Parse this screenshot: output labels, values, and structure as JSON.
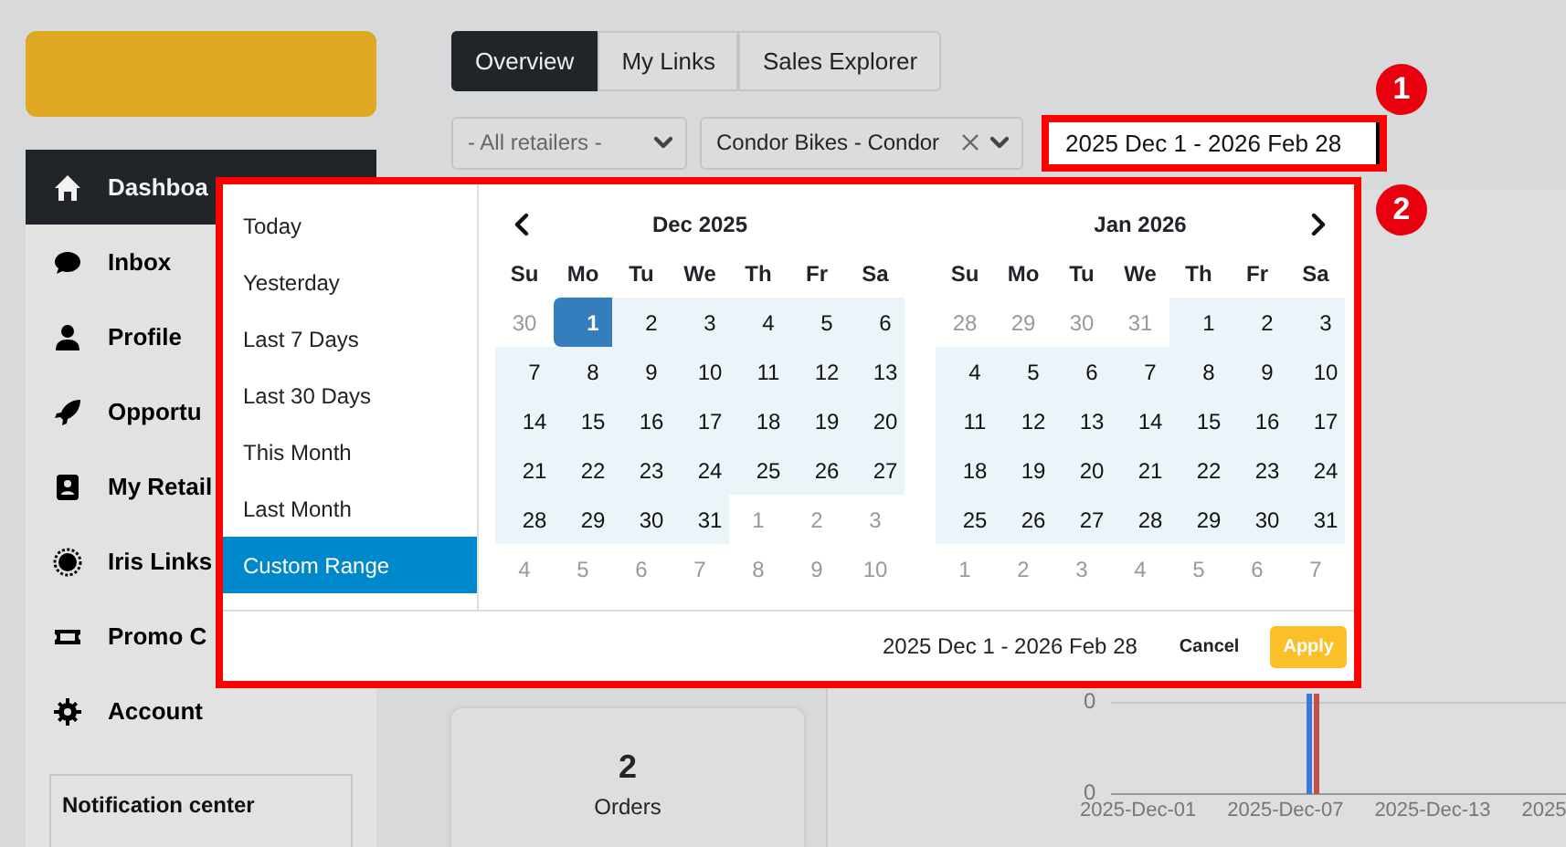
{
  "sidebar": {
    "items": [
      {
        "label": "Dashboa",
        "selected": true
      },
      {
        "label": "Inbox",
        "selected": false
      },
      {
        "label": "Profile",
        "selected": false
      },
      {
        "label": "Opportu",
        "selected": false
      },
      {
        "label": "My Retail",
        "selected": false
      },
      {
        "label": "Iris Links",
        "selected": false
      },
      {
        "label": "Promo C",
        "selected": false
      },
      {
        "label": "Account",
        "selected": false
      }
    ],
    "notification_center": {
      "title": "Notification center"
    }
  },
  "tabs": [
    {
      "label": "Overview",
      "selected": true
    },
    {
      "label": "My Links",
      "selected": false
    },
    {
      "label": "Sales Explorer",
      "selected": false
    }
  ],
  "filters": {
    "retailer": {
      "value": "- All retailers -"
    },
    "brand": {
      "value": "Condor Bikes - Condor"
    },
    "date_range": {
      "value": "2025 Dec 1 - 2026 Feb 28"
    }
  },
  "stat_card": {
    "value": "2",
    "label": "Orders"
  },
  "chart": {
    "y_labels": [
      "0",
      "0"
    ],
    "x_labels": [
      "2025-Dec-01",
      "2025-Dec-07",
      "2025-Dec-13",
      "2025"
    ]
  },
  "date_picker": {
    "ranges": [
      {
        "label": "Today",
        "selected": false
      },
      {
        "label": "Yesterday",
        "selected": false
      },
      {
        "label": "Last 7 Days",
        "selected": false
      },
      {
        "label": "Last 30 Days",
        "selected": false
      },
      {
        "label": "This Month",
        "selected": false
      },
      {
        "label": "Last Month",
        "selected": false
      },
      {
        "label": "Custom Range",
        "selected": true
      }
    ],
    "months": [
      {
        "title": "Dec 2025",
        "weekdays": [
          "Su",
          "Mo",
          "Tu",
          "We",
          "Th",
          "Fr",
          "Sa"
        ],
        "weeks": [
          [
            {
              "day": "30",
              "outside": true,
              "in_range": false,
              "selected": false
            },
            {
              "day": "1",
              "outside": false,
              "in_range": true,
              "selected": true
            },
            {
              "day": "2",
              "outside": false,
              "in_range": true,
              "selected": false
            },
            {
              "day": "3",
              "outside": false,
              "in_range": true,
              "selected": false
            },
            {
              "day": "4",
              "outside": false,
              "in_range": true,
              "selected": false
            },
            {
              "day": "5",
              "outside": false,
              "in_range": true,
              "selected": false
            },
            {
              "day": "6",
              "outside": false,
              "in_range": true,
              "selected": false
            }
          ],
          [
            {
              "day": "7",
              "outside": false,
              "in_range": true,
              "selected": false
            },
            {
              "day": "8",
              "outside": false,
              "in_range": true,
              "selected": false
            },
            {
              "day": "9",
              "outside": false,
              "in_range": true,
              "selected": false
            },
            {
              "day": "10",
              "outside": false,
              "in_range": true,
              "selected": false
            },
            {
              "day": "11",
              "outside": false,
              "in_range": true,
              "selected": false
            },
            {
              "day": "12",
              "outside": false,
              "in_range": true,
              "selected": false
            },
            {
              "day": "13",
              "outside": false,
              "in_range": true,
              "selected": false
            }
          ],
          [
            {
              "day": "14",
              "outside": false,
              "in_range": true,
              "selected": false
            },
            {
              "day": "15",
              "outside": false,
              "in_range": true,
              "selected": false
            },
            {
              "day": "16",
              "outside": false,
              "in_range": true,
              "selected": false
            },
            {
              "day": "17",
              "outside": false,
              "in_range": true,
              "selected": false
            },
            {
              "day": "18",
              "outside": false,
              "in_range": true,
              "selected": false
            },
            {
              "day": "19",
              "outside": false,
              "in_range": true,
              "selected": false
            },
            {
              "day": "20",
              "outside": false,
              "in_range": true,
              "selected": false
            }
          ],
          [
            {
              "day": "21",
              "outside": false,
              "in_range": true,
              "selected": false
            },
            {
              "day": "22",
              "outside": false,
              "in_range": true,
              "selected": false
            },
            {
              "day": "23",
              "outside": false,
              "in_range": true,
              "selected": false
            },
            {
              "day": "24",
              "outside": false,
              "in_range": true,
              "selected": false
            },
            {
              "day": "25",
              "outside": false,
              "in_range": true,
              "selected": false
            },
            {
              "day": "26",
              "outside": false,
              "in_range": true,
              "selected": false
            },
            {
              "day": "27",
              "outside": false,
              "in_range": true,
              "selected": false
            }
          ],
          [
            {
              "day": "28",
              "outside": false,
              "in_range": true,
              "selected": false
            },
            {
              "day": "29",
              "outside": false,
              "in_range": true,
              "selected": false
            },
            {
              "day": "30",
              "outside": false,
              "in_range": true,
              "selected": false
            },
            {
              "day": "31",
              "outside": false,
              "in_range": true,
              "selected": false
            },
            {
              "day": "1",
              "outside": true,
              "in_range": false,
              "selected": false
            },
            {
              "day": "2",
              "outside": true,
              "in_range": false,
              "selected": false
            },
            {
              "day": "3",
              "outside": true,
              "in_range": false,
              "selected": false
            }
          ],
          [
            {
              "day": "4",
              "outside": true,
              "in_range": false,
              "selected": false
            },
            {
              "day": "5",
              "outside": true,
              "in_range": false,
              "selected": false
            },
            {
              "day": "6",
              "outside": true,
              "in_range": false,
              "selected": false
            },
            {
              "day": "7",
              "outside": true,
              "in_range": false,
              "selected": false
            },
            {
              "day": "8",
              "outside": true,
              "in_range": false,
              "selected": false
            },
            {
              "day": "9",
              "outside": true,
              "in_range": false,
              "selected": false
            },
            {
              "day": "10",
              "outside": true,
              "in_range": false,
              "selected": false
            }
          ]
        ]
      },
      {
        "title": "Jan 2026",
        "weekdays": [
          "Su",
          "Mo",
          "Tu",
          "We",
          "Th",
          "Fr",
          "Sa"
        ],
        "weeks": [
          [
            {
              "day": "28",
              "outside": true,
              "in_range": false,
              "selected": false
            },
            {
              "day": "29",
              "outside": true,
              "in_range": false,
              "selected": false
            },
            {
              "day": "30",
              "outside": true,
              "in_range": false,
              "selected": false
            },
            {
              "day": "31",
              "outside": true,
              "in_range": false,
              "selected": false
            },
            {
              "day": "1",
              "outside": false,
              "in_range": true,
              "selected": false
            },
            {
              "day": "2",
              "outside": false,
              "in_range": true,
              "selected": false
            },
            {
              "day": "3",
              "outside": false,
              "in_range": true,
              "selected": false
            }
          ],
          [
            {
              "day": "4",
              "outside": false,
              "in_range": true,
              "selected": false
            },
            {
              "day": "5",
              "outside": false,
              "in_range": true,
              "selected": false
            },
            {
              "day": "6",
              "outside": false,
              "in_range": true,
              "selected": false
            },
            {
              "day": "7",
              "outside": false,
              "in_range": true,
              "selected": false
            },
            {
              "day": "8",
              "outside": false,
              "in_range": true,
              "selected": false
            },
            {
              "day": "9",
              "outside": false,
              "in_range": true,
              "selected": false
            },
            {
              "day": "10",
              "outside": false,
              "in_range": true,
              "selected": false
            }
          ],
          [
            {
              "day": "11",
              "outside": false,
              "in_range": true,
              "selected": false
            },
            {
              "day": "12",
              "outside": false,
              "in_range": true,
              "selected": false
            },
            {
              "day": "13",
              "outside": false,
              "in_range": true,
              "selected": false
            },
            {
              "day": "14",
              "outside": false,
              "in_range": true,
              "selected": false
            },
            {
              "day": "15",
              "outside": false,
              "in_range": true,
              "selected": false
            },
            {
              "day": "16",
              "outside": false,
              "in_range": true,
              "selected": false
            },
            {
              "day": "17",
              "outside": false,
              "in_range": true,
              "selected": false
            }
          ],
          [
            {
              "day": "18",
              "outside": false,
              "in_range": true,
              "selected": false
            },
            {
              "day": "19",
              "outside": false,
              "in_range": true,
              "selected": false
            },
            {
              "day": "20",
              "outside": false,
              "in_range": true,
              "selected": false
            },
            {
              "day": "21",
              "outside": false,
              "in_range": true,
              "selected": false
            },
            {
              "day": "22",
              "outside": false,
              "in_range": true,
              "selected": false
            },
            {
              "day": "23",
              "outside": false,
              "in_range": true,
              "selected": false
            },
            {
              "day": "24",
              "outside": false,
              "in_range": true,
              "selected": false
            }
          ],
          [
            {
              "day": "25",
              "outside": false,
              "in_range": true,
              "selected": false
            },
            {
              "day": "26",
              "outside": false,
              "in_range": true,
              "selected": false
            },
            {
              "day": "27",
              "outside": false,
              "in_range": true,
              "selected": false
            },
            {
              "day": "28",
              "outside": false,
              "in_range": true,
              "selected": false
            },
            {
              "day": "29",
              "outside": false,
              "in_range": true,
              "selected": false
            },
            {
              "day": "30",
              "outside": false,
              "in_range": true,
              "selected": false
            },
            {
              "day": "31",
              "outside": false,
              "in_range": true,
              "selected": false
            }
          ],
          [
            {
              "day": "1",
              "outside": true,
              "in_range": false,
              "selected": false
            },
            {
              "day": "2",
              "outside": true,
              "in_range": false,
              "selected": false
            },
            {
              "day": "3",
              "outside": true,
              "in_range": false,
              "selected": false
            },
            {
              "day": "4",
              "outside": true,
              "in_range": false,
              "selected": false
            },
            {
              "day": "5",
              "outside": true,
              "in_range": false,
              "selected": false
            },
            {
              "day": "6",
              "outside": true,
              "in_range": false,
              "selected": false
            },
            {
              "day": "7",
              "outside": true,
              "in_range": false,
              "selected": false
            }
          ]
        ]
      }
    ],
    "summary": "2025 Dec 1 - 2026 Feb 28",
    "buttons": [
      {
        "label": "Cancel",
        "kind": "plain"
      },
      {
        "label": "Apply",
        "kind": "primary"
      }
    ]
  },
  "callouts": [
    "1",
    "2"
  ]
}
